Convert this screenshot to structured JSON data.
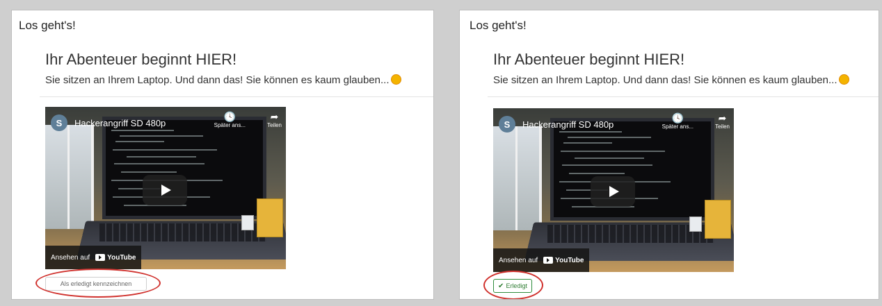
{
  "panels": [
    {
      "section_title": "Los geht's!",
      "heading": "Ihr Abenteuer beginnt HIER!",
      "lead": "Sie sitzen an Ihrem Laptop. Und dann das! Sie können es kaum glauben...",
      "video": {
        "channel_initial": "S",
        "title": "Hackerangriff SD 480p",
        "watch_later_label": "Später ans...",
        "share_label": "Teilen",
        "watch_on_label": "Ansehen auf",
        "youtube_label": "YouTube"
      },
      "completion_button_label": "Als erledigt kennzeichnen"
    },
    {
      "section_title": "Los geht's!",
      "heading": "Ihr Abenteuer beginnt HIER!",
      "lead": "Sie sitzen an Ihrem Laptop. Und dann das! Sie können es kaum glauben...",
      "video": {
        "channel_initial": "S",
        "title": "Hackerangriff SD 480p",
        "watch_later_label": "Später ans...",
        "share_label": "Teilen",
        "watch_on_label": "Ansehen auf",
        "youtube_label": "YouTube"
      },
      "completion_button_label": "Erledigt"
    }
  ],
  "icons": {
    "emoji": "smiley-emoji-icon",
    "watch_later": "clock-icon",
    "share": "share-arrow-icon",
    "play": "play-icon",
    "youtube": "youtube-logo-icon",
    "done": "checkmark-icon"
  },
  "colors": {
    "annotation_red": "#d0312d",
    "done_green": "#2e7d32"
  }
}
